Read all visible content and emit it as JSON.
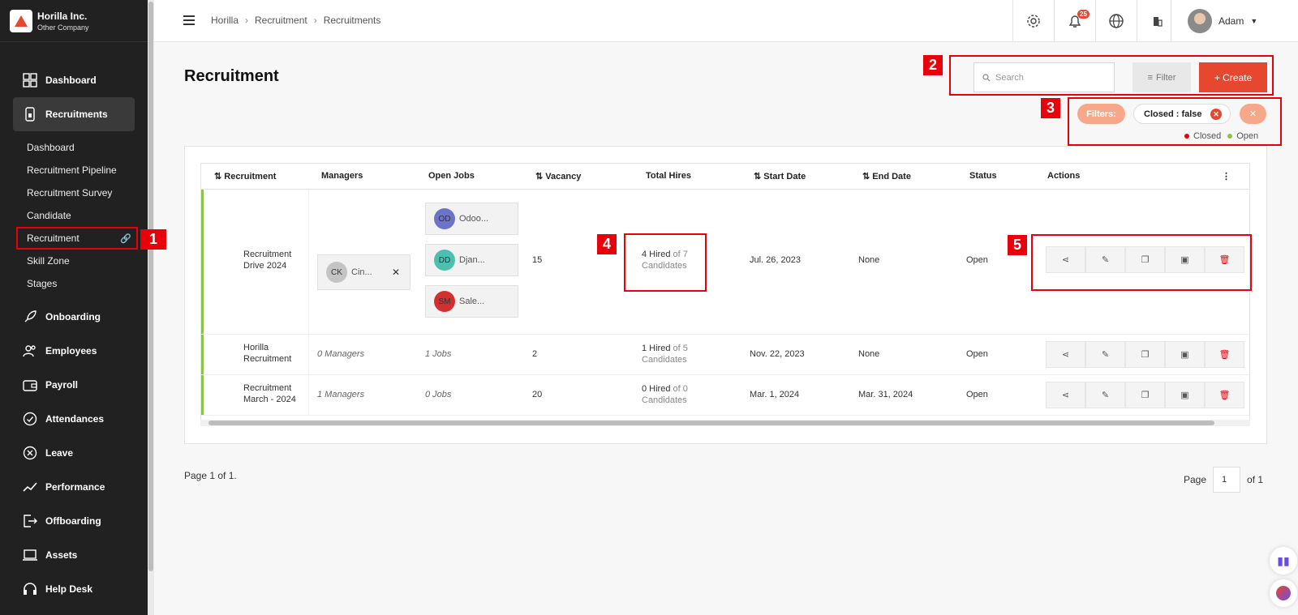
{
  "brand": {
    "name": "Horilla Inc.",
    "sub": "Other Company"
  },
  "sidebar": {
    "items_top": [
      {
        "label": "Dashboard",
        "icon": "dashboard-grid-icon"
      },
      {
        "label": "Recruitments",
        "icon": "tablet-icon"
      }
    ],
    "sub_items": [
      "Dashboard",
      "Recruitment Pipeline",
      "Recruitment Survey",
      "Candidate",
      "Recruitment",
      "Skill Zone",
      "Stages"
    ],
    "items_bottom": [
      {
        "label": "Onboarding",
        "icon": "rocket-icon"
      },
      {
        "label": "Employees",
        "icon": "people-icon"
      },
      {
        "label": "Payroll",
        "icon": "wallet-icon"
      },
      {
        "label": "Attendances",
        "icon": "check-circle-icon"
      },
      {
        "label": "Leave",
        "icon": "x-circle-icon"
      },
      {
        "label": "Performance",
        "icon": "trend-icon"
      },
      {
        "label": "Offboarding",
        "icon": "exit-icon"
      },
      {
        "label": "Assets",
        "icon": "laptop-icon"
      },
      {
        "label": "Help Desk",
        "icon": "headset-icon"
      }
    ]
  },
  "breadcrumb": [
    "Horilla",
    "Recruitment",
    "Recruitments"
  ],
  "header": {
    "notif_count": "25",
    "user": "Adam"
  },
  "page": {
    "title": "Recruitment"
  },
  "toolbar": {
    "search_placeholder": "Search",
    "filter_label": "Filter",
    "create_label": "+ Create"
  },
  "filters": {
    "label": "Filters:",
    "chip": "Closed : false",
    "legend": [
      "Closed",
      "Open"
    ],
    "colors": {
      "closed": "#e8000b",
      "open": "#8bc34a"
    }
  },
  "annotations": [
    "1",
    "2",
    "3",
    "4",
    "5"
  ],
  "table": {
    "headers": [
      "Recruitment",
      "Managers",
      "Open Jobs",
      "Vacancy",
      "Total Hires",
      "Start Date",
      "End Date",
      "Status",
      "Actions"
    ],
    "rows": [
      {
        "name": "Recruitment Drive 2024",
        "manager": {
          "initials": "CK",
          "name": "Cin..."
        },
        "jobs": [
          {
            "initials": "OD",
            "name": "Odoo...",
            "color": "#6b74c9"
          },
          {
            "initials": "DD",
            "name": "Djan...",
            "color": "#4dbfb0"
          },
          {
            "initials": "SM",
            "name": "Sale...",
            "color": "#d32f2f"
          }
        ],
        "vacancy": "15",
        "hired": "4 Hired",
        "of": "of 7",
        "cand": "Candidates",
        "start": "Jul. 26, 2023",
        "end": "None",
        "status": "Open"
      },
      {
        "name": "Horilla Recruitment",
        "managers_text": "0 Managers",
        "jobs_text": "1 Jobs",
        "vacancy": "2",
        "hired": "1 Hired",
        "of": "of 5",
        "cand": "Candidates",
        "start": "Nov. 22, 2023",
        "end": "None",
        "status": "Open"
      },
      {
        "name": "Recruitment March - 2024",
        "managers_text": "1 Managers",
        "jobs_text": "0 Jobs",
        "vacancy": "20",
        "hired": "0 Hired",
        "of": "of 0",
        "cand": "Candidates",
        "start": "Mar. 1, 2024",
        "end": "Mar. 31, 2024",
        "status": "Open"
      }
    ]
  },
  "pagination": {
    "info": "Page 1 of 1.",
    "page_label": "Page",
    "current": "1",
    "of_label": "of 1"
  }
}
